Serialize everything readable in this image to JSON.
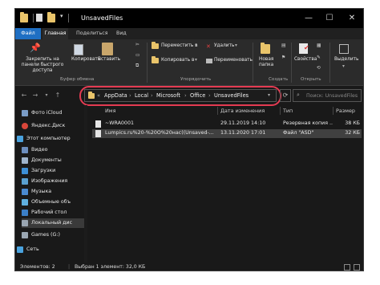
{
  "window": {
    "title": "UnsavedFiles",
    "controls": {
      "minimize": "—",
      "maximize": "☐",
      "close": "✕"
    }
  },
  "ribbon_tabs": [
    "Файл",
    "Главная",
    "Поделиться",
    "Вид"
  ],
  "ribbon": {
    "pin_label": "Закрепить на панели быстрого доступа",
    "copy_label": "Копировать",
    "paste_label": "Вставить",
    "group_clipboard": "Буфер обмена",
    "move_to": "Переместить в",
    "copy_to": "Копировать в",
    "delete": "Удалить",
    "rename": "Переименовать",
    "group_organize": "Упорядочить",
    "new_folder": "Новая папка",
    "group_create": "Создать",
    "properties": "Свойства",
    "group_open": "Открыть",
    "select": "Выделить",
    "accent_color": "#1f6fc3"
  },
  "address": {
    "crumbs": [
      "AppData",
      "Local",
      "Microsoft",
      "Office",
      "UnsavedFiles"
    ],
    "overflow": "«",
    "highlight_color": "#e53b52"
  },
  "search": {
    "placeholder": "Поиск: UnsavedFiles"
  },
  "navigation": {
    "back": "←",
    "forward": "→",
    "up": "↑"
  },
  "sidebar": {
    "items": [
      {
        "label": "Фото iCloud",
        "icon": "photo-icon",
        "color": "#7a9cc6"
      },
      {
        "label": "Яндекс.Диск",
        "icon": "cloud-icon",
        "color": "#d9463a"
      },
      {
        "label": "Этот компьютер",
        "icon": "computer-icon",
        "color": "#4aa3df"
      },
      {
        "label": "Видео",
        "icon": "video-icon",
        "color": "#6c8ebf"
      },
      {
        "label": "Документы",
        "icon": "documents-icon",
        "color": "#9fb4cc"
      },
      {
        "label": "Загрузки",
        "icon": "downloads-icon",
        "color": "#3d8fd6"
      },
      {
        "label": "Изображения",
        "icon": "pictures-icon",
        "color": "#5aa0d0"
      },
      {
        "label": "Музыка",
        "icon": "music-icon",
        "color": "#4a8ad0"
      },
      {
        "label": "Объемные объ",
        "icon": "3d-objects-icon",
        "color": "#5fb0e0"
      },
      {
        "label": "Рабочий стол",
        "icon": "desktop-icon",
        "color": "#3b7fc7"
      },
      {
        "label": "Локальный дис",
        "icon": "drive-icon",
        "color": "#9aa6b2"
      },
      {
        "label": "Games (G:)",
        "icon": "drive-icon",
        "color": "#9aa6b2"
      },
      {
        "label": "Сеть",
        "icon": "network-icon",
        "color": "#4aa3df"
      }
    ]
  },
  "table": {
    "columns": [
      "Имя",
      "Дата изменения",
      "Тип",
      "Размер"
    ],
    "rows": [
      {
        "name": "~WRA0001",
        "date": "29.11.2019 14:10",
        "type": "Резервная копия ...",
        "size": "38 КБ"
      },
      {
        "name": "Lumpics.ru%20-%20O%20нас((Unsaved-...",
        "date": "13.11.2020 17:01",
        "type": "Файл \"ASD\"",
        "size": "32 КБ"
      }
    ]
  },
  "status": {
    "count": "Элементов: 2",
    "selection": "Выбран 1 элемент: 32,0 КБ"
  }
}
